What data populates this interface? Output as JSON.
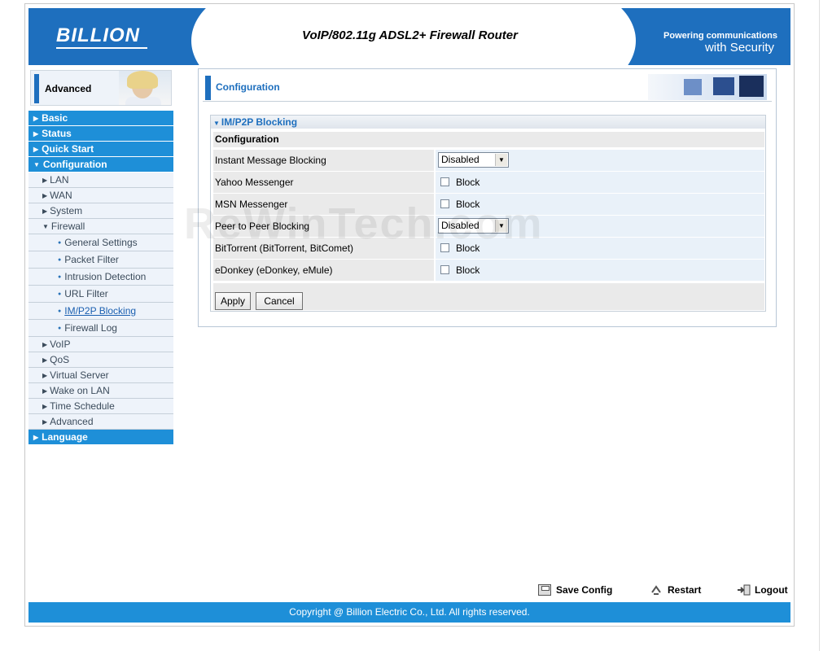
{
  "header": {
    "logo": "BILLION",
    "product": "VoIP/802.11g ADSL2+ Firewall Router",
    "tagline_top": "Powering communications",
    "tagline_bottom": "with Security"
  },
  "sidebar": {
    "mode_label": "Advanced",
    "items": [
      {
        "label": "Basic",
        "level": 0
      },
      {
        "label": "Status",
        "level": 0
      },
      {
        "label": "Quick Start",
        "level": 0
      },
      {
        "label": "Configuration",
        "level": 0,
        "expanded": true
      },
      {
        "label": "LAN",
        "level": 1
      },
      {
        "label": "WAN",
        "level": 1
      },
      {
        "label": "System",
        "level": 1
      },
      {
        "label": "Firewall",
        "level": 1,
        "expanded": true
      },
      {
        "label": "General Settings",
        "level": 2
      },
      {
        "label": "Packet Filter",
        "level": 2
      },
      {
        "label": "Intrusion Detection",
        "level": 2
      },
      {
        "label": "URL Filter",
        "level": 2
      },
      {
        "label": "IM/P2P Blocking",
        "level": 2,
        "active": true
      },
      {
        "label": "Firewall Log",
        "level": 2
      },
      {
        "label": "VoIP",
        "level": 1
      },
      {
        "label": "QoS",
        "level": 1
      },
      {
        "label": "Virtual Server",
        "level": 1
      },
      {
        "label": "Wake on LAN",
        "level": 1
      },
      {
        "label": "Time Schedule",
        "level": 1
      },
      {
        "label": "Advanced",
        "level": 1
      },
      {
        "label": "Language",
        "level": 0
      }
    ]
  },
  "main": {
    "panel_title": "Configuration",
    "section_title": "IM/P2P Blocking",
    "table_header": "Configuration",
    "rows": [
      {
        "label": "Instant Message Blocking",
        "type": "select",
        "value": "Disabled"
      },
      {
        "label": "Yahoo Messenger",
        "type": "checkbox",
        "value": "Block",
        "checked": false
      },
      {
        "label": "MSN Messenger",
        "type": "checkbox",
        "value": "Block",
        "checked": false
      },
      {
        "label": "Peer to Peer Blocking",
        "type": "select",
        "value": "Disabled"
      },
      {
        "label": "BitTorrent (BitTorrent, BitComet)",
        "type": "checkbox",
        "value": "Block",
        "checked": false
      },
      {
        "label": "eDonkey (eDonkey, eMule)",
        "type": "checkbox",
        "value": "Block",
        "checked": false
      }
    ],
    "apply_label": "Apply",
    "cancel_label": "Cancel"
  },
  "bottom": {
    "save_label": "Save Config",
    "restart_label": "Restart",
    "logout_label": "Logout"
  },
  "footer": {
    "copyright": "Copyright @ Billion Electric Co., Ltd. All rights reserved."
  },
  "watermark": "ReWinTech.com",
  "colors": {
    "brand_blue": "#1e6fbe",
    "nav_blue": "#1e8fd8"
  }
}
